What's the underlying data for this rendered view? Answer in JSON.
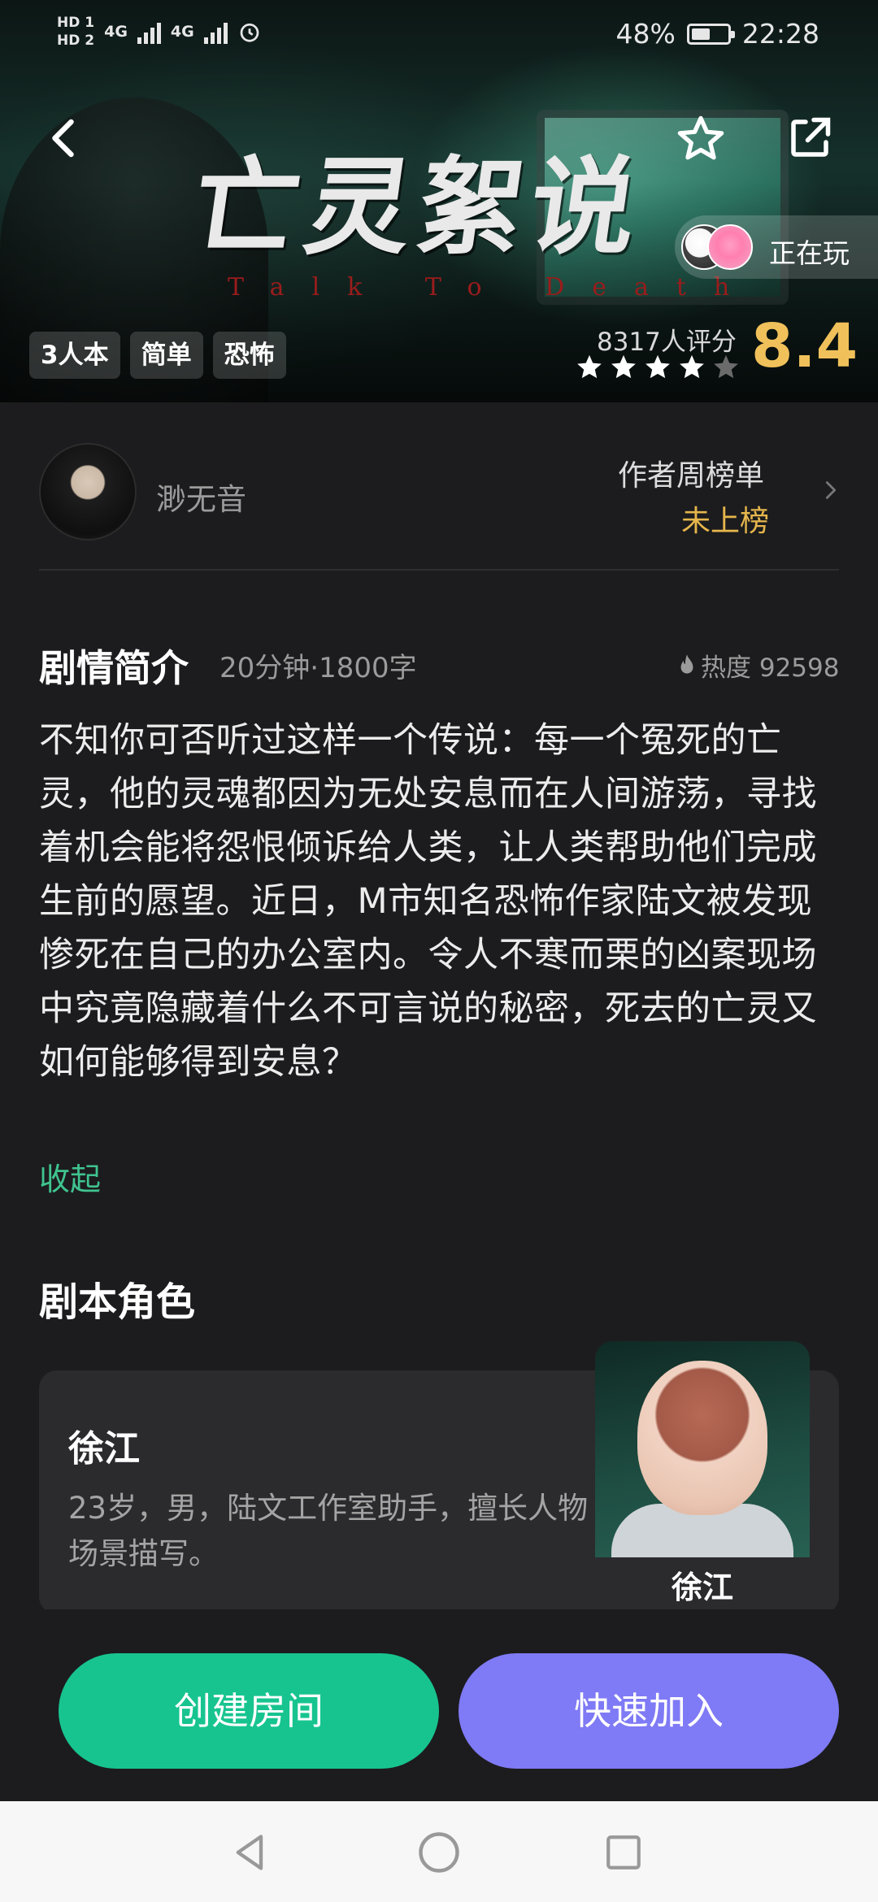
{
  "status_bar": {
    "hd1": "HD 1",
    "hd2": "HD 2",
    "net1": "4G",
    "net2": "4G",
    "battery": "48%",
    "time": "22:28"
  },
  "hero": {
    "title": "亡灵絮说",
    "subtitle": "Talk To Death",
    "now_playing": "正在玩",
    "tags": [
      "3人本",
      "简单",
      "恐怖"
    ],
    "rating_count": "8317人评分",
    "rating_score": "8.4",
    "stars_filled": 4,
    "stars_total": 5
  },
  "author": {
    "name": "渺无音",
    "rank_title": "作者周榜单",
    "rank_value": "未上榜"
  },
  "synopsis": {
    "title": "剧情简介",
    "meta": "20分钟·1800字",
    "heat": "热度 92598",
    "body": "不知你可否听过这样一个传说：每一个冤死的亡灵，他的灵魂都因为无处安息而在人间游荡，寻找着机会能将怨恨倾诉给人类，让人类帮助他们完成生前的愿望。近日，M市知名恐怖作家陆文被发现惨死在自己的办公室内。令人不寒而栗的凶案现场中究竟隐藏着什么不可言说的秘密，死去的亡灵又如何能够得到安息？",
    "collapse": "收起"
  },
  "roles": {
    "title": "剧本角色",
    "items": [
      {
        "name": "徐江",
        "desc": "23岁，男，陆文工作室助手，擅长人物场景描写。",
        "label": "徐江"
      }
    ]
  },
  "actions": {
    "create_room": "创建房间",
    "quick_join": "快速加入"
  },
  "colors": {
    "accent_green": "#17c48f",
    "accent_purple": "#7f7af5",
    "score_gold": "#f0c15a",
    "rank_gold": "#e6b64c",
    "background": "#1c1c1e"
  }
}
